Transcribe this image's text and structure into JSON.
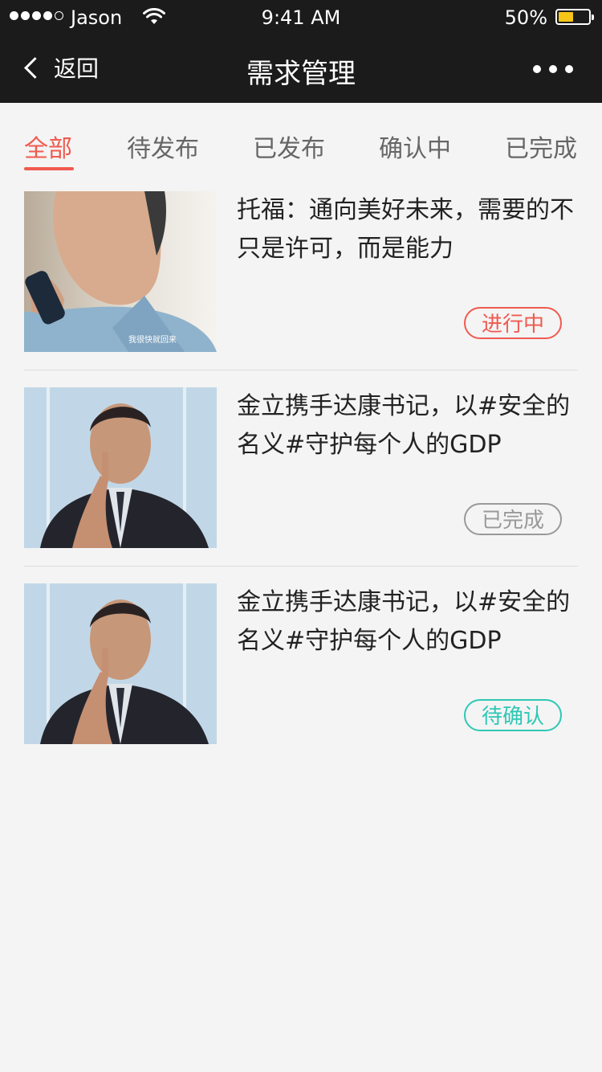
{
  "status_bar": {
    "carrier": "Jason",
    "time": "9:41 AM",
    "battery_percent": "50%",
    "battery_level": 0.5,
    "battery_color": "#f5c518"
  },
  "nav": {
    "back_label": "返回",
    "title": "需求管理",
    "more_icon": "more-dots-icon"
  },
  "tabs": [
    {
      "label": "全部",
      "active": true
    },
    {
      "label": "待发布",
      "active": false
    },
    {
      "label": "已发布",
      "active": false
    },
    {
      "label": "确认中",
      "active": false
    },
    {
      "label": "已完成",
      "active": false
    }
  ],
  "items": [
    {
      "title": "托福：通向美好未来，需要的不只是许可，而是能力",
      "thumb_caption": "我很快就回来",
      "status": "进行中",
      "status_color": "#f05a4f"
    },
    {
      "title": "金立携手达康书记，以#安全的名义#守护每个人的GDP",
      "status": "已完成",
      "status_color": "#999999"
    },
    {
      "title": "金立携手达康书记，以#安全的名义#守护每个人的GDP",
      "status": "待确认",
      "status_color": "#2ec7b5"
    }
  ],
  "colors": {
    "accent": "#f05a4f",
    "bar_background": "#1b1b1b",
    "page_background": "#f4f4f4"
  }
}
